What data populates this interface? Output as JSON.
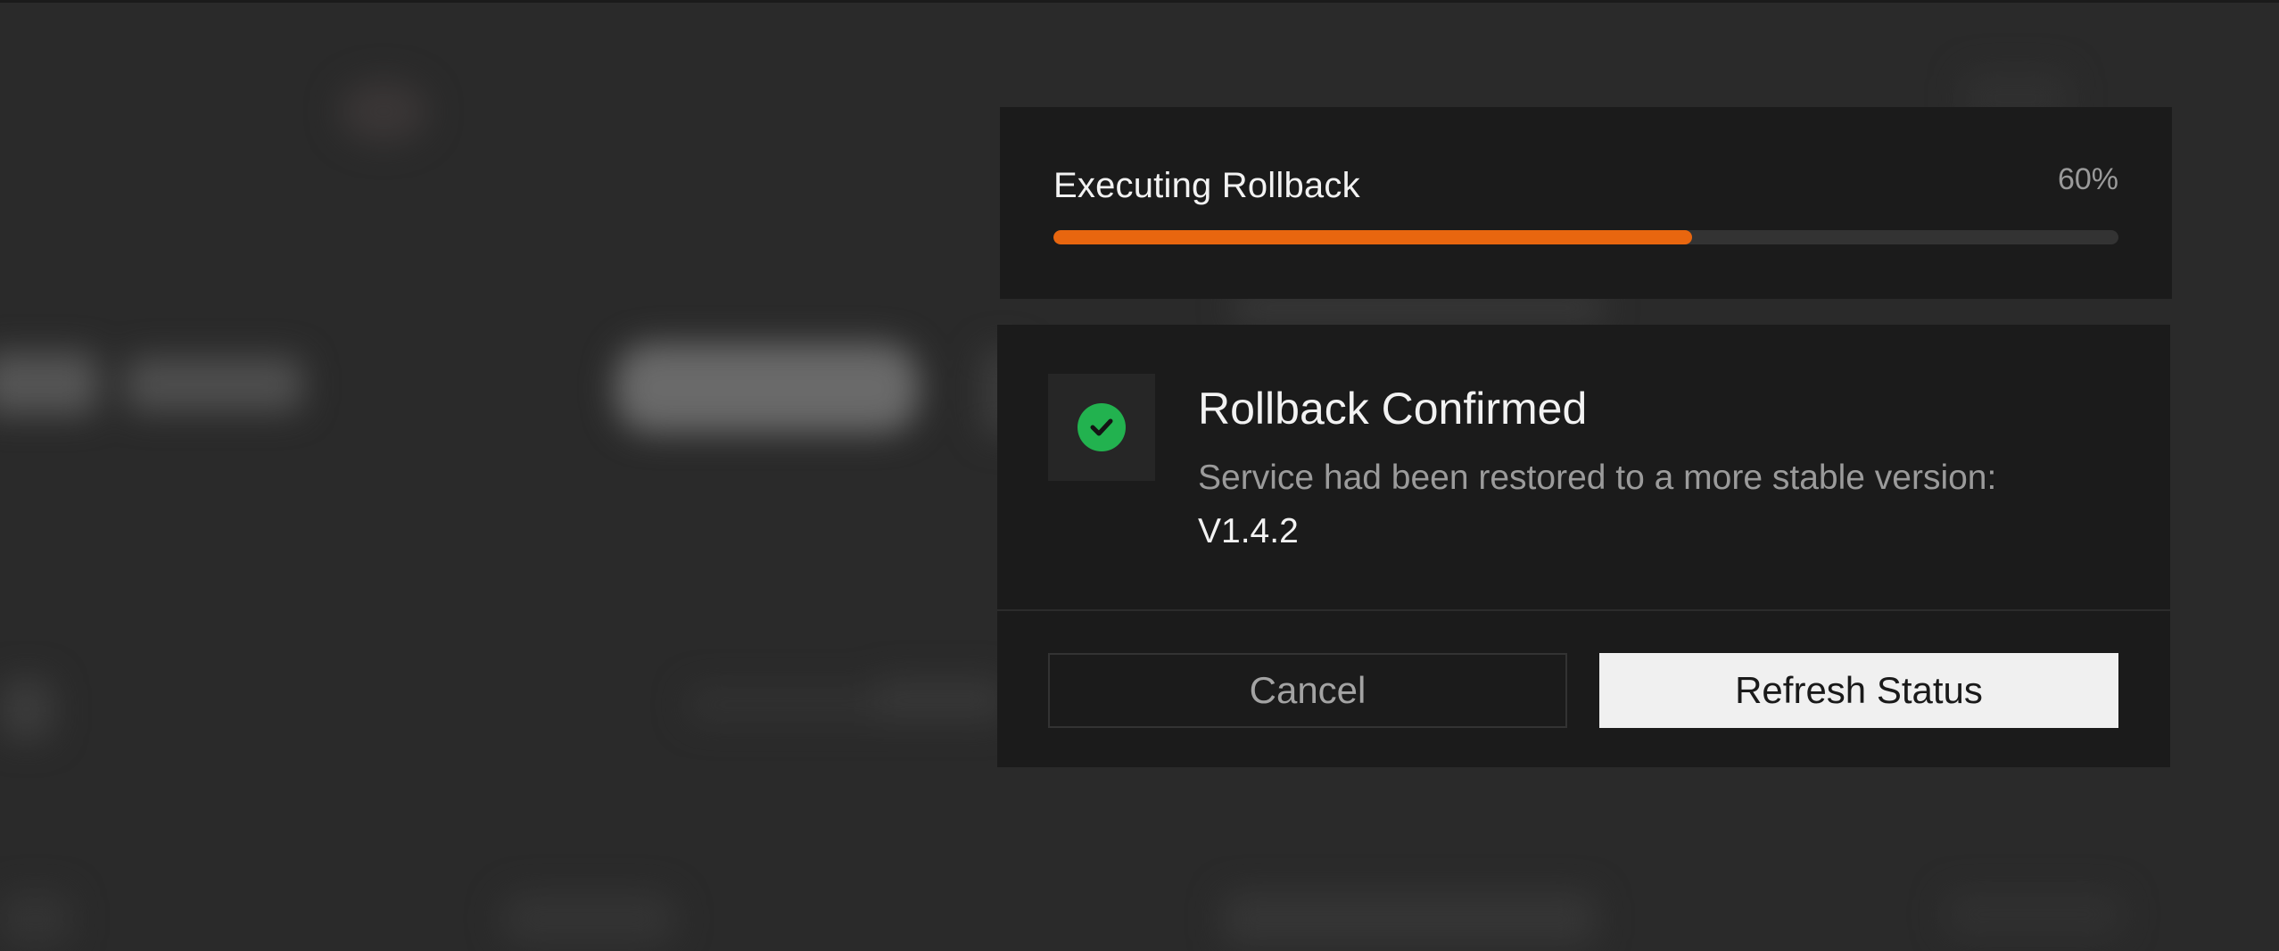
{
  "progress": {
    "title": "Executing Rollback",
    "percent_label": "60%",
    "percent_value": 0.6,
    "accent_color": "#e8660f"
  },
  "confirmation": {
    "status_icon": "check-circle-icon",
    "status_color": "#22b24f",
    "title": "Rollback Confirmed",
    "message": "Service had been restored to a more stable version:",
    "version": "V1.4.2"
  },
  "actions": {
    "cancel_label": "Cancel",
    "refresh_label": "Refresh Status"
  }
}
